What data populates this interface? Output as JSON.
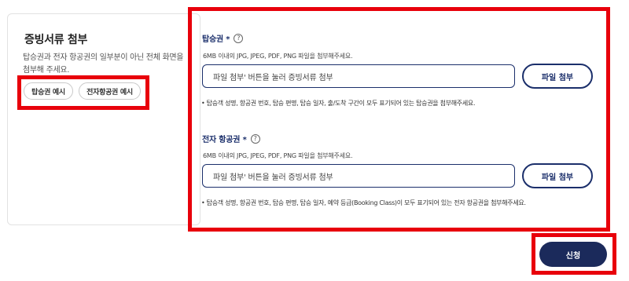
{
  "left_panel": {
    "title": "증빙서류 첨부",
    "description": "탑승권과 전자 항공권의 일부분이 아닌 전체 화면을 첨부해 주세요.",
    "examples": [
      "탑승권 예시",
      "전자항공권 예시"
    ]
  },
  "boarding_pass": {
    "label": "탑승권 *",
    "help_icon": "?",
    "hint": "6MB 이내의 JPG, JPEG, PDF, PNG 파일을 첨부해주세요.",
    "placeholder": "파일 첨부' 버튼을 눌러 증빙서류 첨부",
    "attach_label": "파일 첨부",
    "note": "• 탑승객 성명, 항공권 번호, 탑승 편명, 탑승 일자, 출/도착 구간이 모두 표기되어 있는 탑승권을 첨부해주세요."
  },
  "e_ticket": {
    "label": "전자 항공권 *",
    "help_icon": "?",
    "hint": "6MB 이내의 JPG, JPEG, PDF, PNG 파일을 첨부해주세요.",
    "placeholder": "파일 첨부' 버튼을 눌러 증빙서류 첨부",
    "attach_label": "파일 첨부",
    "note": "• 탑승객 성명, 항공권 번호, 탑승 편명, 탑승 일자, 예약 등급(Booking Class)이 모두 표기되어 있는 전자 항공권을 첨부해주세요."
  },
  "submit_label": "신청",
  "colors": {
    "navy": "#1b2f6b",
    "submit_bg": "#1b2a5b",
    "highlight_red": "#e8000b"
  }
}
